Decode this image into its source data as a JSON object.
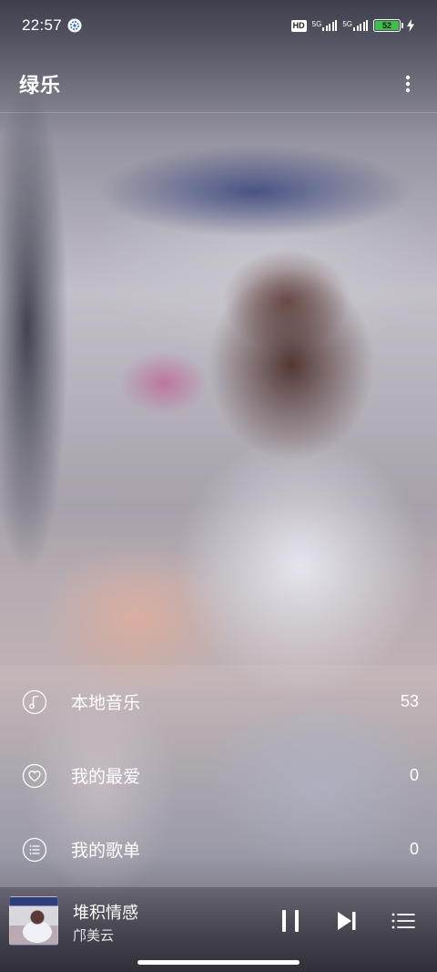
{
  "status_bar": {
    "time": "22:57",
    "hd_label": "HD",
    "network_1": "5G",
    "network_2": "5G",
    "battery": "52",
    "icons": [
      "gear-icon",
      "signal-icon",
      "battery-icon",
      "charging-icon"
    ]
  },
  "app_bar": {
    "title": "绿乐",
    "more_icon": "more-vertical-icon"
  },
  "menu": {
    "items": [
      {
        "label": "本地音乐",
        "count": "53",
        "icon": "music-note-icon"
      },
      {
        "label": "我的最爱",
        "count": "0",
        "icon": "heart-icon"
      },
      {
        "label": "我的歌单",
        "count": "0",
        "icon": "playlist-icon"
      }
    ]
  },
  "player": {
    "title": "堆积情感",
    "artist": "邝美云",
    "controls": [
      "pause-icon",
      "skip-next-icon",
      "queue-icon"
    ]
  },
  "colors": {
    "battery_fill": "#3fbf4a",
    "text": "#ffffff"
  }
}
